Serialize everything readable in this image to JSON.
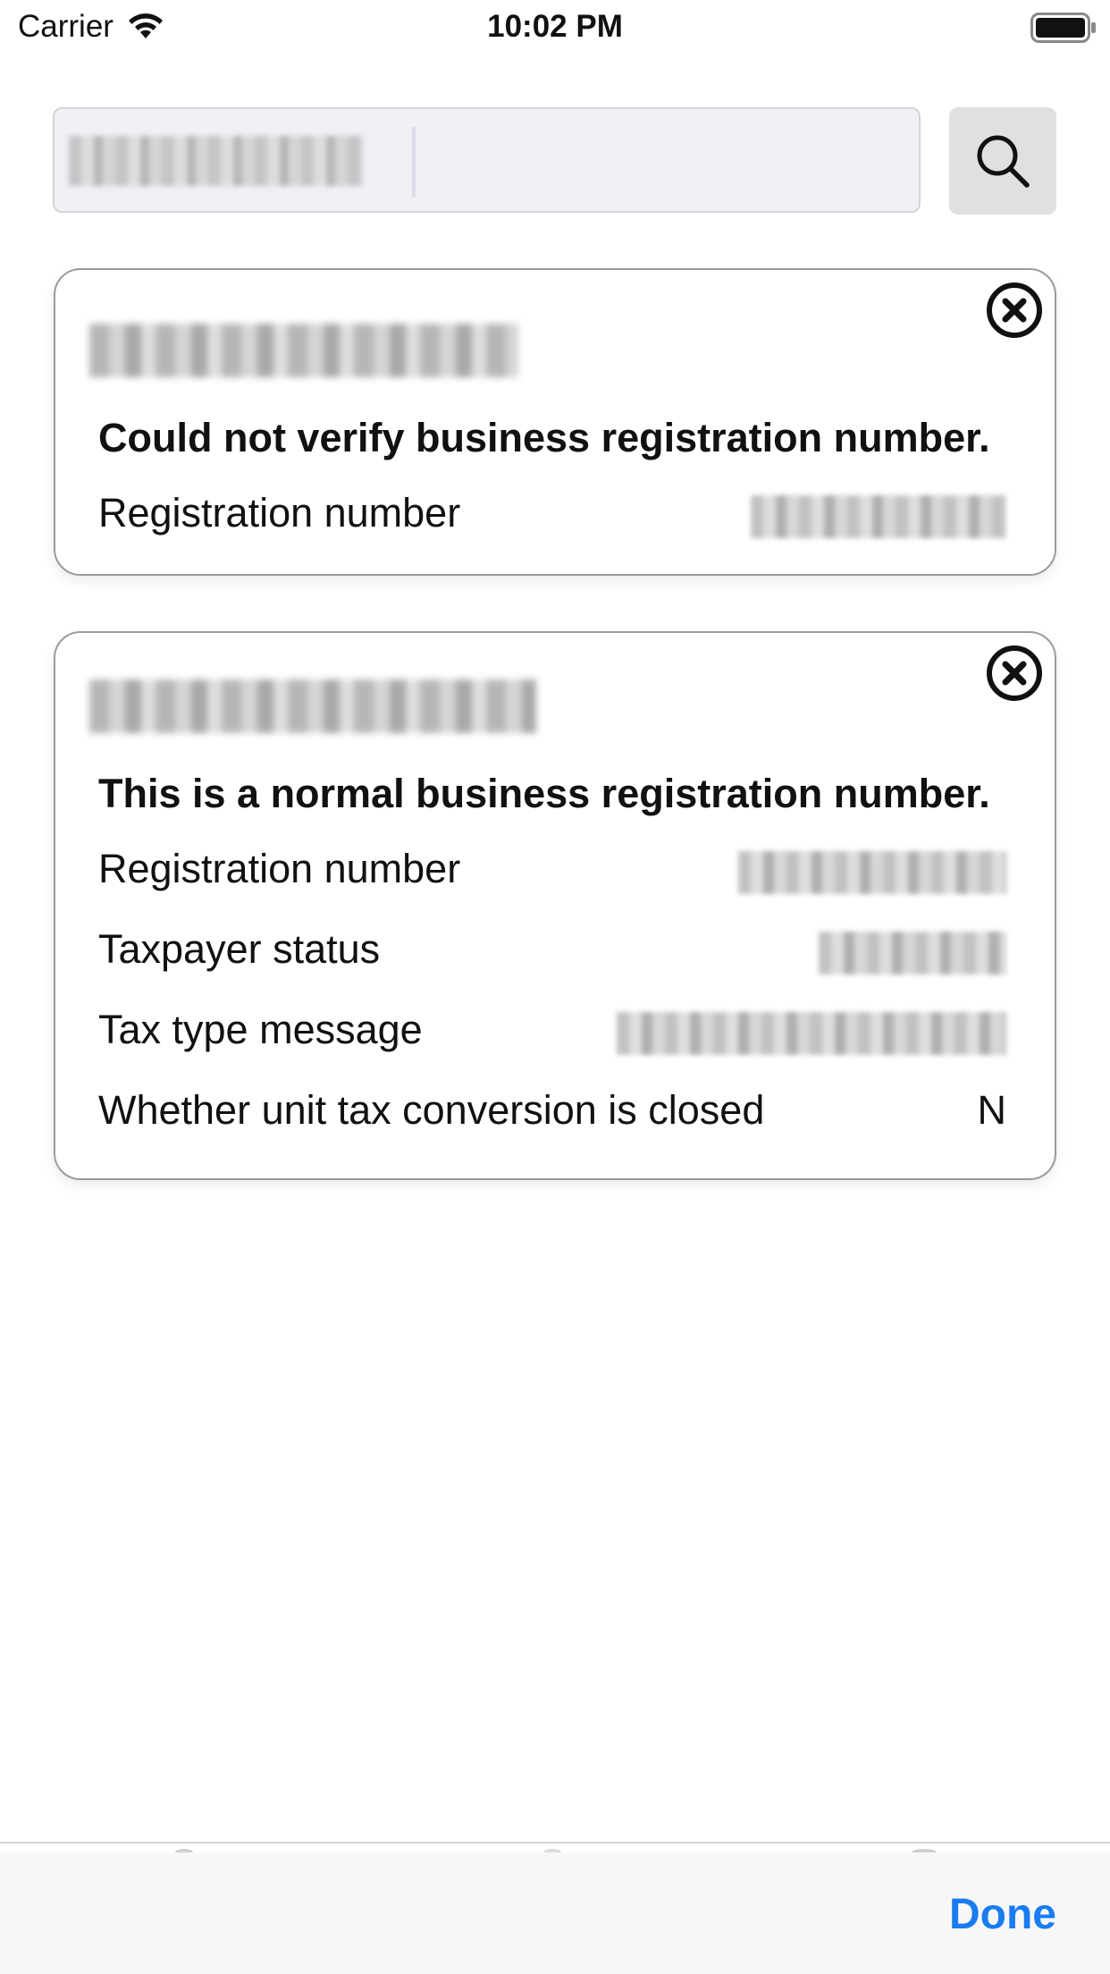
{
  "status_bar": {
    "carrier": "Carrier",
    "time": "10:02 PM"
  },
  "search": {
    "button_icon": "search-icon"
  },
  "results": [
    {
      "message": "Could not verify business registration number.",
      "rows": [
        {
          "label": "Registration number"
        }
      ]
    },
    {
      "message": "This is a normal business registration number.",
      "rows": [
        {
          "label": "Registration number"
        },
        {
          "label": "Taxpayer status"
        },
        {
          "label": "Tax type message"
        },
        {
          "label": "Whether unit tax conversion is closed",
          "value": "N"
        }
      ]
    }
  ],
  "toolbar": {
    "done_label": "Done"
  },
  "colors": {
    "accent": "#1a7cf0",
    "card_border": "#9b9b9b",
    "search_bg": "#f0f0f5",
    "search_button_bg": "#e0e0e0"
  }
}
